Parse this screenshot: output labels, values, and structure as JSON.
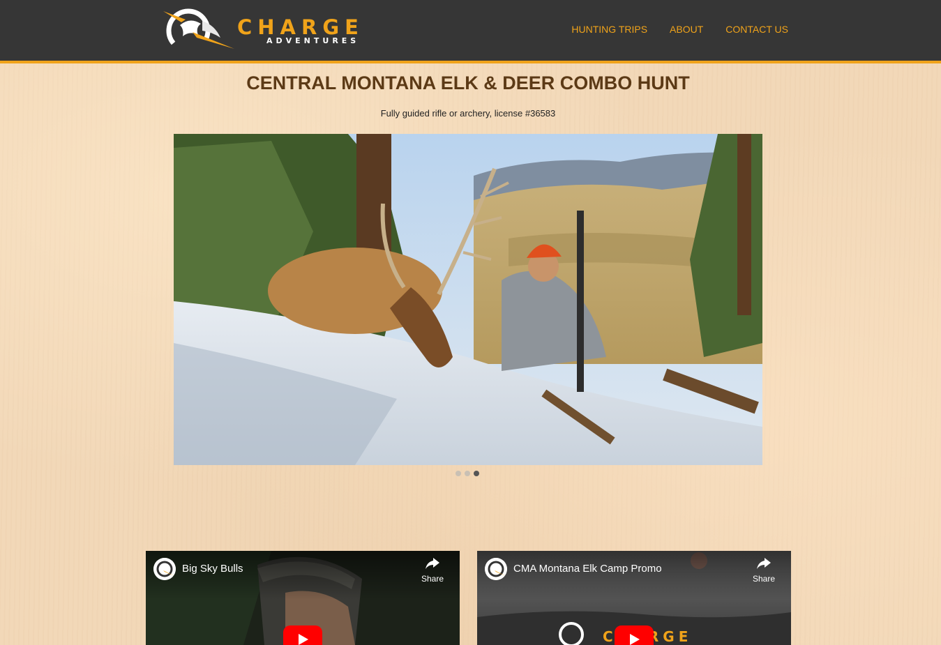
{
  "brand": {
    "name": "CHARGE",
    "tagline": "ADVENTURES",
    "accent_color": "#f0a31a",
    "header_color": "#363636"
  },
  "nav": {
    "items": [
      {
        "label": "HUNTING TRIPS"
      },
      {
        "label": "ABOUT"
      },
      {
        "label": "CONTACT US"
      }
    ]
  },
  "page": {
    "title": "CENTRAL MONTANA ELK & DEER COMBO HUNT",
    "subtitle": "Fully guided rifle or archery, license #36583",
    "title_color": "#5c3a16"
  },
  "slideshow": {
    "total_slides": 3,
    "active_slide": 3
  },
  "videos": [
    {
      "title": "Big Sky Bulls",
      "share_label": "Share",
      "icon": "play-icon"
    },
    {
      "title": "CMA Montana Elk Camp Promo",
      "share_label": "Share",
      "icon": "play-icon"
    }
  ],
  "video_brand_overlay": "CHARGE"
}
